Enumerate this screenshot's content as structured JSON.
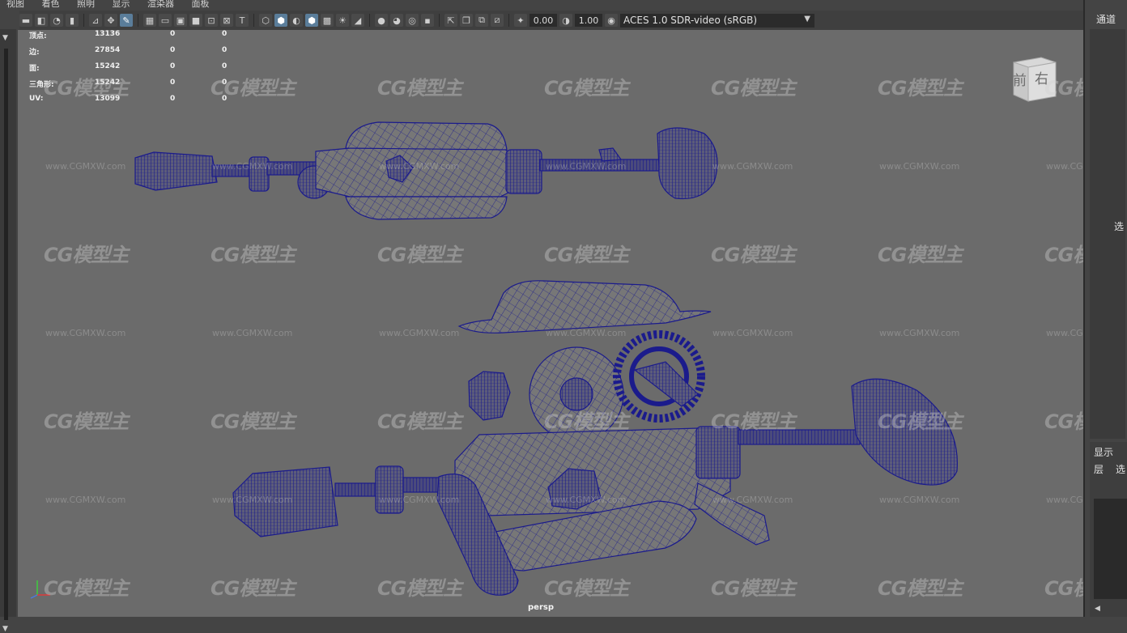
{
  "menu": [
    "视图",
    "着色",
    "照明",
    "显示",
    "渲染器",
    "面板"
  ],
  "toolbar": {
    "exposure_value": "0.00",
    "gamma_value": "1.00",
    "color_space": "ACES 1.0 SDR-video (sRGB)"
  },
  "hud": {
    "rows": [
      {
        "label": "顶点:",
        "v1": "13136",
        "v2": "0",
        "v3": "0"
      },
      {
        "label": "边:",
        "v1": "27854",
        "v2": "0",
        "v3": "0"
      },
      {
        "label": "面:",
        "v1": "15242",
        "v2": "0",
        "v3": "0"
      },
      {
        "label": "三角形:",
        "v1": "15242",
        "v2": "0",
        "v3": "0"
      },
      {
        "label": "UV:",
        "v1": "13099",
        "v2": "0",
        "v3": "0"
      }
    ]
  },
  "viewcube": {
    "front": "前",
    "right": "右"
  },
  "camera_label": "persp",
  "watermark": {
    "logo": "CG模型主",
    "url": "www.CGMXW.com"
  },
  "right_panel": {
    "tab": "通道",
    "select": "选",
    "display": "显示",
    "layer": "层",
    "layer_option": "选"
  },
  "colors": {
    "wireframe": "#1b1b8c",
    "mesh_fill": "#767676",
    "viewport_bg": "#6b6b6b"
  }
}
